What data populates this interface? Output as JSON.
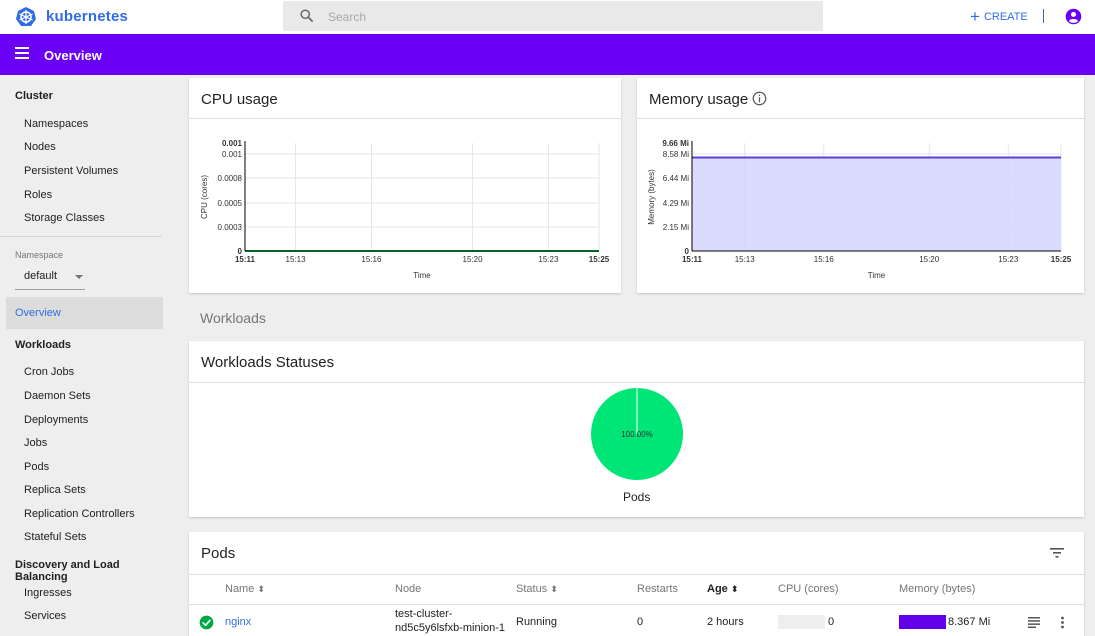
{
  "app": {
    "brand": "kubernetes"
  },
  "search": {
    "placeholder": "Search",
    "value": ""
  },
  "toolbar": {
    "create_label": "CREATE"
  },
  "band": {
    "title": "Overview"
  },
  "sidebar": {
    "cluster_heading": "Cluster",
    "cluster_items": [
      "Namespaces",
      "Nodes",
      "Persistent Volumes",
      "Roles",
      "Storage Classes"
    ],
    "namespace_label": "Namespace",
    "namespace_value": "default",
    "active_item": "Overview",
    "workloads_heading": "Workloads",
    "workload_items": [
      "Cron Jobs",
      "Daemon Sets",
      "Deployments",
      "Jobs",
      "Pods",
      "Replica Sets",
      "Replication Controllers",
      "Stateful Sets"
    ],
    "discovery_heading": "Discovery and Load Balancing",
    "discovery_items": [
      "Ingresses",
      "Services"
    ]
  },
  "cpu_card": {
    "title": "CPU usage"
  },
  "memory_card": {
    "title": "Memory usage"
  },
  "workloads_section": "Workloads",
  "statuses_card": {
    "title": "Workloads Statuses",
    "pie_label": "100.00%",
    "pie_caption": "Pods"
  },
  "pods_card": {
    "title": "Pods",
    "columns": [
      "Name",
      "Node",
      "Status",
      "Restarts",
      "Age",
      "CPU (cores)",
      "Memory (bytes)"
    ],
    "rows": [
      {
        "name": "nginx",
        "node_line1": "test-cluster-",
        "node_line2": "nd5c5y6lsfxb-minion-1",
        "status": "Running",
        "restarts": "0",
        "age": "2 hours",
        "cpu": "0",
        "memory": "8.367 Mi"
      }
    ]
  },
  "chart_data": [
    {
      "type": "line",
      "title": "CPU usage",
      "xlabel": "Time",
      "ylabel": "CPU (cores)",
      "x_ticks": [
        "15:11",
        "15:13",
        "15:16",
        "15:20",
        "15:23",
        "15:25"
      ],
      "y_ticks": [
        "0",
        "0.0003",
        "0.0005",
        "0.0008",
        "0.001",
        "0.001"
      ],
      "ylim": [
        0,
        0.001
      ],
      "series": [
        {
          "color": "#00c752",
          "x": [
            "15:11",
            "15:25"
          ],
          "y": [
            0,
            0
          ]
        }
      ],
      "grid": true
    },
    {
      "type": "area",
      "title": "Memory usage",
      "xlabel": "Time",
      "ylabel": "Memory (bytes)",
      "x_ticks": [
        "15:11",
        "15:13",
        "15:16",
        "15:20",
        "15:23",
        "15:25"
      ],
      "y_ticks": [
        "0",
        "2.15 Mi",
        "4.29 Mi",
        "6.44 Mi",
        "8.58 Mi",
        "9.66 Mi"
      ],
      "ylim": [
        0,
        9.66
      ],
      "series": [
        {
          "color": "#5d3fd3",
          "fill": "#d3d5ff",
          "x": [
            "15:11",
            "15:25"
          ],
          "y": [
            8.367,
            8.367
          ]
        }
      ],
      "grid": true
    },
    {
      "type": "pie",
      "title": "Workloads Statuses",
      "slices": [
        {
          "label": "100.00%",
          "value": 100,
          "color": "#00e676"
        }
      ],
      "caption": "Pods"
    }
  ],
  "colors": {
    "brand": "#326ce5",
    "band": "#6a00f4",
    "running": "#00c752",
    "memory_bar": "#6200ea"
  }
}
